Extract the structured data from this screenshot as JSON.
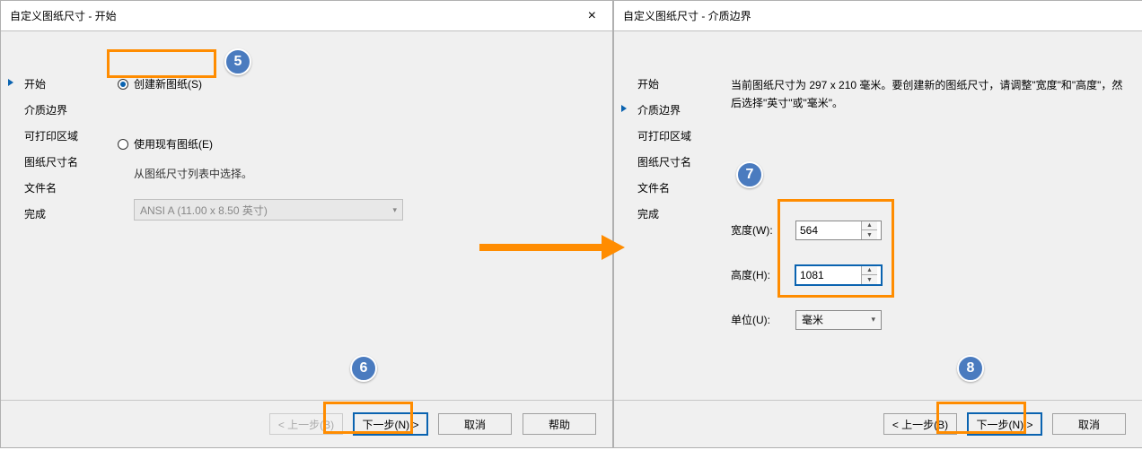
{
  "left_dialog": {
    "title": "自定义图纸尺寸 - 开始",
    "sidebar": {
      "items": [
        {
          "label": "开始"
        },
        {
          "label": "介质边界"
        },
        {
          "label": "可打印区域"
        },
        {
          "label": "图纸尺寸名"
        },
        {
          "label": "文件名"
        },
        {
          "label": "完成"
        }
      ]
    },
    "radio_new": "创建新图纸(S)",
    "radio_existing": "使用现有图纸(E)",
    "hint": "从图纸尺寸列表中选择。",
    "select_value": "ANSI A (11.00 x 8.50 英寸)",
    "buttons": {
      "prev": "< 上一步(B)",
      "next": "下一步(N) >",
      "cancel": "取消",
      "help": "帮助"
    }
  },
  "right_dialog": {
    "title": "自定义图纸尺寸 - 介质边界",
    "sidebar": {
      "items": [
        {
          "label": "开始"
        },
        {
          "label": "介质边界"
        },
        {
          "label": "可打印区域"
        },
        {
          "label": "图纸尺寸名"
        },
        {
          "label": "文件名"
        },
        {
          "label": "完成"
        }
      ]
    },
    "info": "当前图纸尺寸为 297 x 210 毫米。要创建新的图纸尺寸，请调整\"宽度\"和\"高度\"，然后选择\"英寸\"或\"毫米\"。",
    "width_label": "宽度(W):",
    "width_value": "564",
    "height_label": "高度(H):",
    "height_value": "1081",
    "unit_label": "单位(U):",
    "unit_value": "毫米",
    "buttons": {
      "prev": "< 上一步(B)",
      "next": "下一步(N) >",
      "cancel": "取消"
    }
  },
  "callouts": {
    "c5": "5",
    "c6": "6",
    "c7": "7",
    "c8": "8"
  }
}
